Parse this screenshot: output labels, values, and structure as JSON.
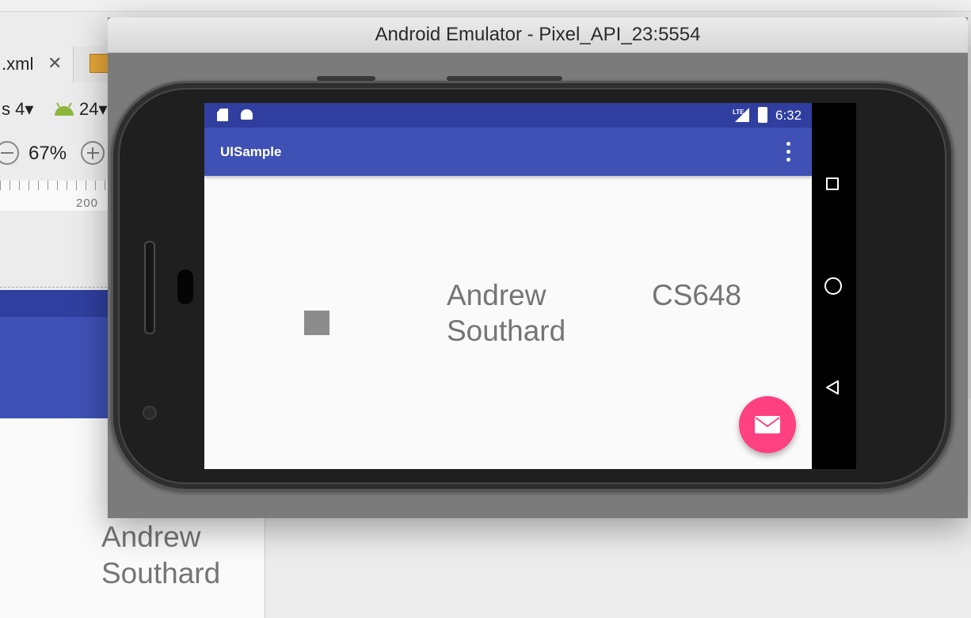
{
  "ide": {
    "tab_label": ".xml",
    "tab_close": "✕",
    "api_label": "s 4▾",
    "api_level": "24▾",
    "zoom_label": "67%",
    "ruler_label": "200",
    "design_name": "Andrew\nSouthard"
  },
  "emulator": {
    "title": "Android Emulator - Pixel_API_23:5554"
  },
  "status_bar": {
    "lte": "LTE",
    "time": "6:32"
  },
  "app": {
    "title": "UISample",
    "name_text": "Andrew Southard",
    "course_text": "CS648"
  },
  "colors": {
    "primary": "#3f51b5",
    "primary_dark": "#303f9f",
    "accent": "#ff4081",
    "text_secondary": "#757575"
  },
  "icons": {
    "sd_card": "sd-card-icon",
    "android": "android-icon",
    "signal": "signal-icon",
    "battery": "battery-icon",
    "overflow": "more-vert-icon",
    "fab": "mail-icon",
    "nav_recent": "recent-apps-icon",
    "nav_home": "home-icon",
    "nav_back": "back-icon"
  }
}
